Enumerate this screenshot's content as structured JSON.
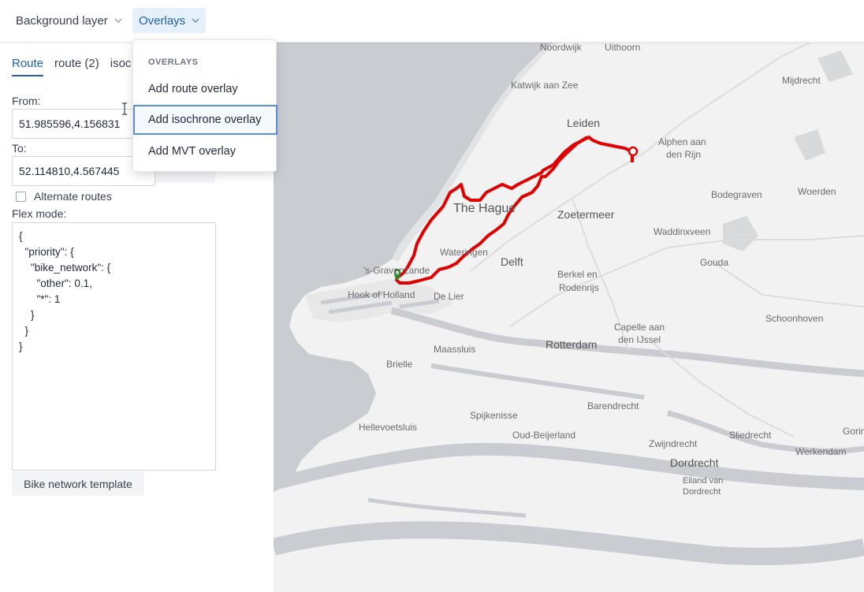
{
  "toolbar": {
    "background_layer_label": "Background layer",
    "overlays_label": "Overlays"
  },
  "overlays_menu": {
    "title": "OVERLAYS",
    "items": [
      "Add route overlay",
      "Add isochrone overlay",
      "Add MVT overlay"
    ],
    "highlighted_index": 1
  },
  "sidebar": {
    "tabs": [
      "Route",
      "route (2)",
      "isoc"
    ],
    "active_tab": 0,
    "from_label": "From:",
    "from_value": "51.985596,4.156831",
    "to_label": "To:",
    "to_value": "52.114810,4.567445",
    "alternate_routes_label": "Alternate routes",
    "alternate_routes_checked": false,
    "flex_mode_label": "Flex mode:",
    "flex_mode_value": "{\n  \"priority\": {\n    \"bike_network\": {\n      \"other\": 0.1,\n      \"*\": 1\n    }\n  }\n}",
    "template_button_label": "Bike network template"
  },
  "map": {
    "route_color": "#e10000",
    "start_marker_color": "#2e8b2e",
    "end_marker_color": "#e10000",
    "place_labels": {
      "noordwijk": "Noordwijk",
      "uithoorn": "Uithoorn",
      "katwijk": "Katwijk aan Zee",
      "mijdrecht": "Mijdrecht",
      "leiden": "Leiden",
      "alphen1": "Alphen aan",
      "alphen2": "den Rijn",
      "bodegraven": "Bodegraven",
      "woerden": "Woerden",
      "thehague": "The Hague",
      "zoetermeer": "Zoetermeer",
      "waddinxveen": "Waddinxveen",
      "gravenzande": "'s-Gravenzande",
      "wateringen": "Wateringen",
      "delft": "Delft",
      "gouda": "Gouda",
      "berkel1": "Berkel en",
      "berkel2": "Rodenrijs",
      "hookofholland": "Hook of Holland",
      "delier": "De Lier",
      "capelle1": "Capelle aan",
      "capelle2": "den IJssel",
      "schoonhoven": "Schoonhoven",
      "maassluis": "Maassluis",
      "rotterdam": "Rotterdam",
      "brielle": "Brielle",
      "barendrecht": "Barendrecht",
      "spijkenisse": "Spijkenisse",
      "hellevoetsluis": "Hellevoetsluis",
      "oudbeijerland": "Oud-Beijerland",
      "zwijndrecht": "Zwijndrecht",
      "sliedrecht": "Sliedrecht",
      "gorinchem": "Gorin",
      "dordrecht": "Dordrecht",
      "werkendam": "Werkendam",
      "eiland1": "Eiland van",
      "eiland2": "Dordrecht"
    }
  }
}
